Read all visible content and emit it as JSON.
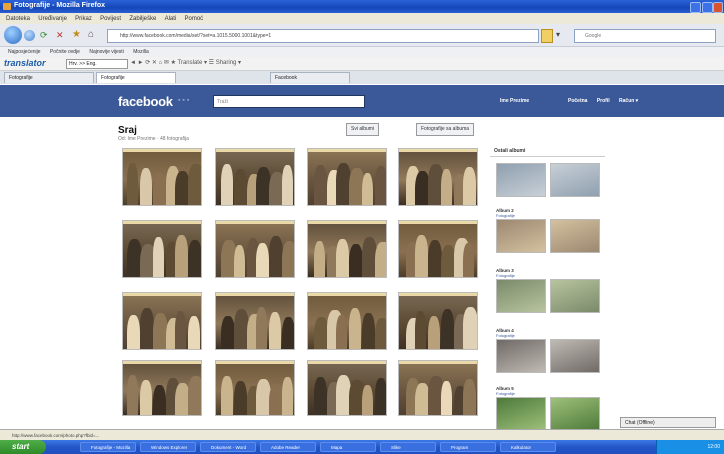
{
  "window": {
    "title": "Fotografije - Mozilla Firefox"
  },
  "menu": [
    "Datoteka",
    "Uređivanje",
    "Prikaz",
    "Povijest",
    "Zabilješke",
    "Alati",
    "Pomoć"
  ],
  "navbar": {
    "url": "http://www.facebook.com/media/set/?set=a.1015.5000.1001&type=1",
    "search_placeholder": "Google"
  },
  "bookmarks": [
    "Najposjećenije",
    "Počnite ovdje",
    "Najnovije vijesti",
    "Mozilla"
  ],
  "translator": {
    "brand": "translator",
    "language": "Hrv. >> Eng.",
    "icons": "◄ ► ⟳ ✕ ⌂ ✉ ★ Translate ▾  ☰ Sharing ▾"
  },
  "tabs": [
    {
      "label": "Fotografije"
    },
    {
      "label": "Fotografije"
    },
    {
      "label": "Facebook"
    }
  ],
  "facebook": {
    "logo": "facebook",
    "search_placeholder": "Traži",
    "user": "Ime Prezime",
    "links": [
      "Početna",
      "Profil",
      "Račun ▾"
    ]
  },
  "album": {
    "title": "Sraj",
    "meta": "Od: Ime Prezime · 48 fotografija",
    "buttons": [
      "Svi albumi",
      "Fotografije sa albuma"
    ]
  },
  "sidebar": {
    "heading": "Ostali albumi",
    "albums": [
      {
        "name": "Album 1",
        "sub": "Fotografije"
      },
      {
        "name": "Album 2",
        "sub": "Fotografije"
      },
      {
        "name": "Album 3",
        "sub": "Fotografije"
      },
      {
        "name": "Album 4",
        "sub": "Fotografije"
      },
      {
        "name": "Album 5",
        "sub": "Fotografije"
      }
    ]
  },
  "chat": "Chat (Offline)",
  "status": "http://www.facebook.com/photo.php?fbid=...",
  "taskbar": {
    "start": "start",
    "tasks": [
      "Fotografije - Mozilla",
      "Windows Explorer",
      "Dokument - Word",
      "Adobe Reader",
      "Mapa",
      "Slike",
      "Program",
      "Kalkulator"
    ],
    "clock": "12:00"
  },
  "colors": {
    "fb_blue": "#3b5998",
    "xp_blue": "#2456c8",
    "start_green": "#2f8a2a"
  }
}
